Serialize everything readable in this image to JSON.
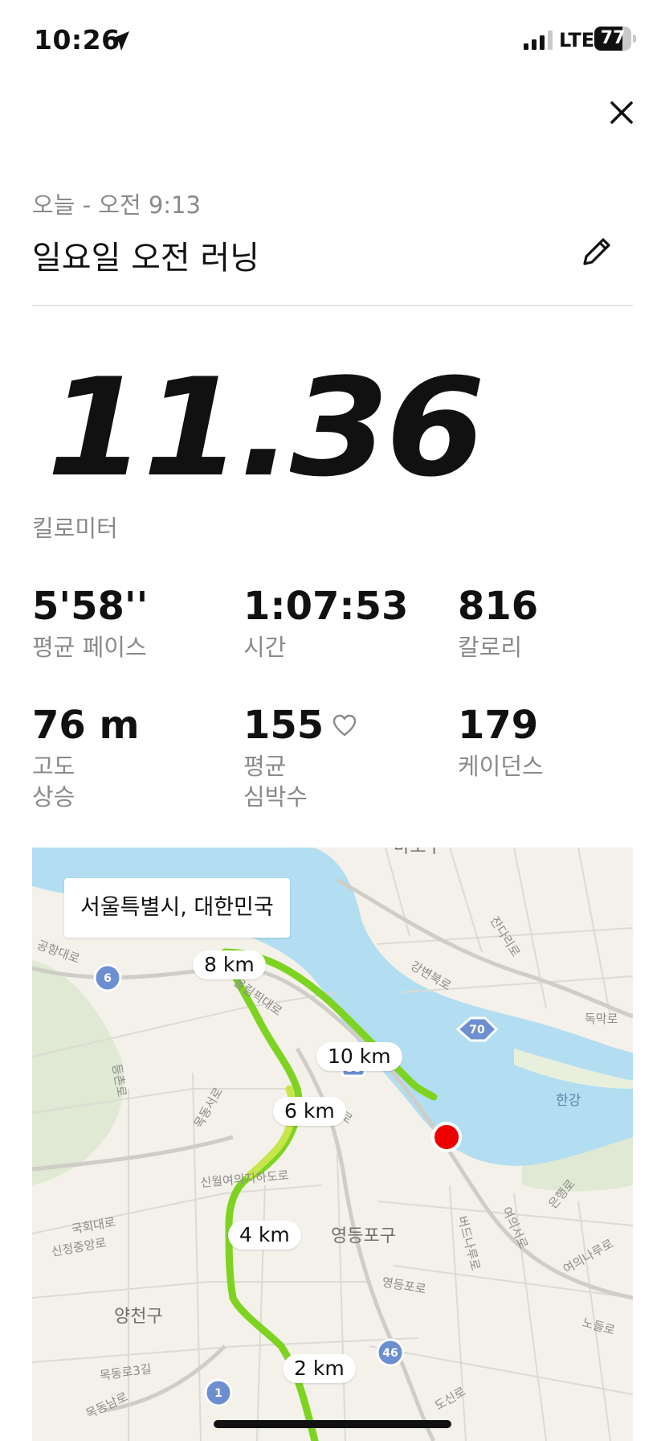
{
  "status_bar": {
    "time": "10:26",
    "network": "LTE",
    "battery": "77",
    "battery_level": 0.77
  },
  "activity": {
    "date_line": "오늘 - 오전 9:13",
    "title": "일요일 오전 러닝",
    "distance": "11.36",
    "distance_unit": "킬로미터"
  },
  "stats": {
    "pace": {
      "value": "5'58''",
      "label": "평균 페이스"
    },
    "time": {
      "value": "1:07:53",
      "label": "시간"
    },
    "calories": {
      "value": "816",
      "label": "칼로리"
    },
    "elevation": {
      "value": "76 m",
      "label_line1": "고도",
      "label_line2": "상승"
    },
    "heart_rate": {
      "value": "155",
      "label_line1": "평균",
      "label_line2": "심박수"
    },
    "cadence": {
      "value": "179",
      "label": "케이던스"
    }
  },
  "map": {
    "location": "서울특별시, 대한민국",
    "km_markers": [
      "8 km",
      "10 km",
      "6 km",
      "4 km",
      "2 km"
    ],
    "districts": [
      "영등포구",
      "양천구",
      "마포구"
    ],
    "roads": [
      "올림픽대로",
      "강변북로",
      "잔다리로",
      "독막로",
      "한강",
      "여의서로",
      "은행로",
      "여의나루로",
      "노들로",
      "도신로",
      "영등포로",
      "버드나루로",
      "신월여의지하도로",
      "국회대로",
      "신정중앙로",
      "목동로3길",
      "목동남로",
      "공항대로",
      "등촌로",
      "목동서로",
      "성산로"
    ],
    "route_badges": [
      "6",
      "70",
      "46",
      "1",
      "88"
    ],
    "route_color": "#7ed321",
    "route_mid_color": "#c8e64c",
    "water_color": "#b3def1",
    "end_marker_color": "#ee0000"
  }
}
